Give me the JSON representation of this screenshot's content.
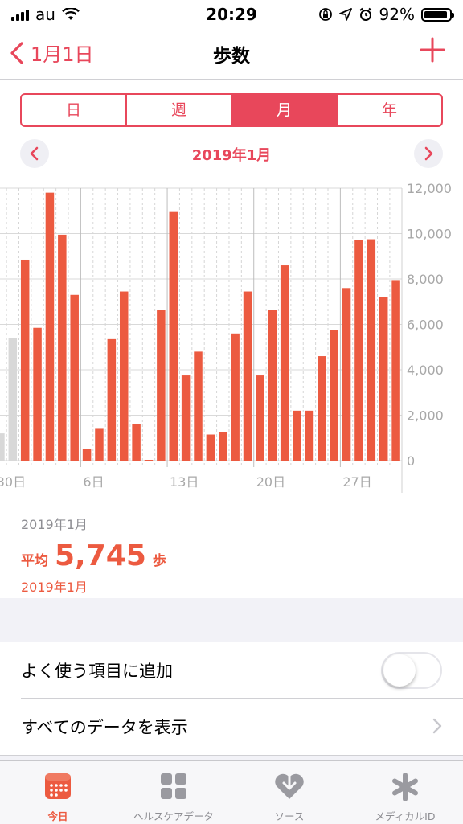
{
  "status": {
    "carrier": "au",
    "time": "20:29",
    "battery": "92%",
    "battery_level": 0.92
  },
  "nav": {
    "back_label": "1月1日",
    "title": "歩数",
    "add_icon": "plus-icon",
    "accent": "#e8475b"
  },
  "segments": [
    {
      "label": "日",
      "active": false
    },
    {
      "label": "週",
      "active": false
    },
    {
      "label": "月",
      "active": true
    },
    {
      "label": "年",
      "active": false
    }
  ],
  "period": {
    "label": "2019年1月"
  },
  "chart_data": {
    "type": "bar",
    "title": "",
    "xlabel": "",
    "ylabel": "",
    "ylim": [
      0,
      12000
    ],
    "y_ticks": [
      "12,000",
      "10,000",
      "8,000",
      "6,000",
      "4,000",
      "2,000",
      "0"
    ],
    "x_tick_labels": [
      "30日",
      "6日",
      "13日",
      "20日",
      "27日"
    ],
    "bar_color": "#ec5a40",
    "previous_month_color": "#d8d8d8",
    "previous_month": {
      "categories": [
        "12/30",
        "12/31"
      ],
      "values": [
        1200,
        5400
      ]
    },
    "categories": [
      "1/1",
      "1/2",
      "1/3",
      "1/4",
      "1/5",
      "1/6",
      "1/7",
      "1/8",
      "1/9",
      "1/10",
      "1/11",
      "1/12",
      "1/13",
      "1/14",
      "1/15",
      "1/16",
      "1/17",
      "1/18",
      "1/19",
      "1/20",
      "1/21",
      "1/22",
      "1/23",
      "1/24",
      "1/25",
      "1/26",
      "1/27",
      "1/28",
      "1/29",
      "1/30",
      "1/31"
    ],
    "values": [
      8850,
      5850,
      11800,
      9950,
      7300,
      500,
      1400,
      5350,
      7450,
      1600,
      0,
      6650,
      10950,
      3750,
      4800,
      1150,
      1250,
      5600,
      7450,
      3750,
      6650,
      8600,
      2200,
      2200,
      4600,
      5750,
      7600,
      9700,
      9750,
      7200,
      7950
    ]
  },
  "summary": {
    "range": "2019年1月",
    "avg_label": "平均",
    "avg_value": "5,745",
    "avg_unit": "歩",
    "date": "2019年1月"
  },
  "list": {
    "favorite_label": "よく使う項目に追加",
    "favorite_on": false,
    "show_all_label": "すべてのデータを表示"
  },
  "tabs": [
    {
      "label": "今日",
      "icon": "calendar-icon",
      "active": true
    },
    {
      "label": "ヘルスケアデータ",
      "icon": "grid-icon",
      "active": false
    },
    {
      "label": "ソース",
      "icon": "heart-arrow-icon",
      "active": false
    },
    {
      "label": "メディカルID",
      "icon": "asterisk-icon",
      "active": false
    }
  ]
}
